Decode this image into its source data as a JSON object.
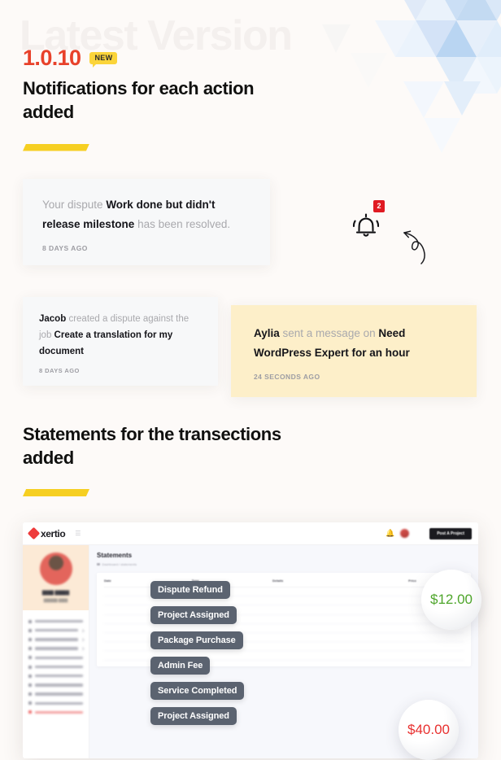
{
  "hero": {
    "ghost_title": "Latest Version",
    "version": "1.0.10",
    "badge": "NEW",
    "title": "Notifications for each action added"
  },
  "notifications": [
    {
      "id": "dispute-resolved",
      "prefix": "Your dispute ",
      "subject": "Work done but didn't release milestone",
      "suffix": " has been resolved.",
      "time": "8 DAYS AGO",
      "tone": "gray"
    },
    {
      "id": "jacob-dispute",
      "prefix": "Jacob",
      "middle": " created a dispute against the job ",
      "subject": "Create a translation for my document",
      "time": "8 DAYS AGO",
      "tone": "gray"
    },
    {
      "id": "aylia-message",
      "prefix": "Aylia",
      "middle": " sent a message on ",
      "subject": "Need WordPress Expert for an hour",
      "time": "24 SECONDS AGO",
      "tone": "cream"
    }
  ],
  "bell": {
    "icon": "bell-ringing-icon",
    "count": "2",
    "arrow": "curved-arrow-icon"
  },
  "statements": {
    "title": "Statements for the transections added"
  },
  "dashboard": {
    "logo": "xertio",
    "post_project_button": "Post A Project",
    "page_title": "Statements",
    "breadcrumb": "Dashboard / statements",
    "columns": [
      "Date",
      "Type",
      "Details",
      "Price"
    ],
    "tags": [
      "Dispute Refund",
      "Project Assigned",
      "Package Purchase",
      "Admin Fee",
      "Service Completed",
      "Project Assigned"
    ],
    "bubbles": [
      {
        "label": "$12.00",
        "tone": "positive"
      },
      {
        "label": "$40.00",
        "tone": "negative"
      }
    ]
  },
  "colors": {
    "accent_red": "#e8412a",
    "accent_yellow": "#f6cf22",
    "badge_red": "#e01a22",
    "cream_card": "#fdefc9",
    "gray_card": "#f7f8f9",
    "positive_green": "#4ea52b",
    "negative_red": "#e8302f"
  }
}
